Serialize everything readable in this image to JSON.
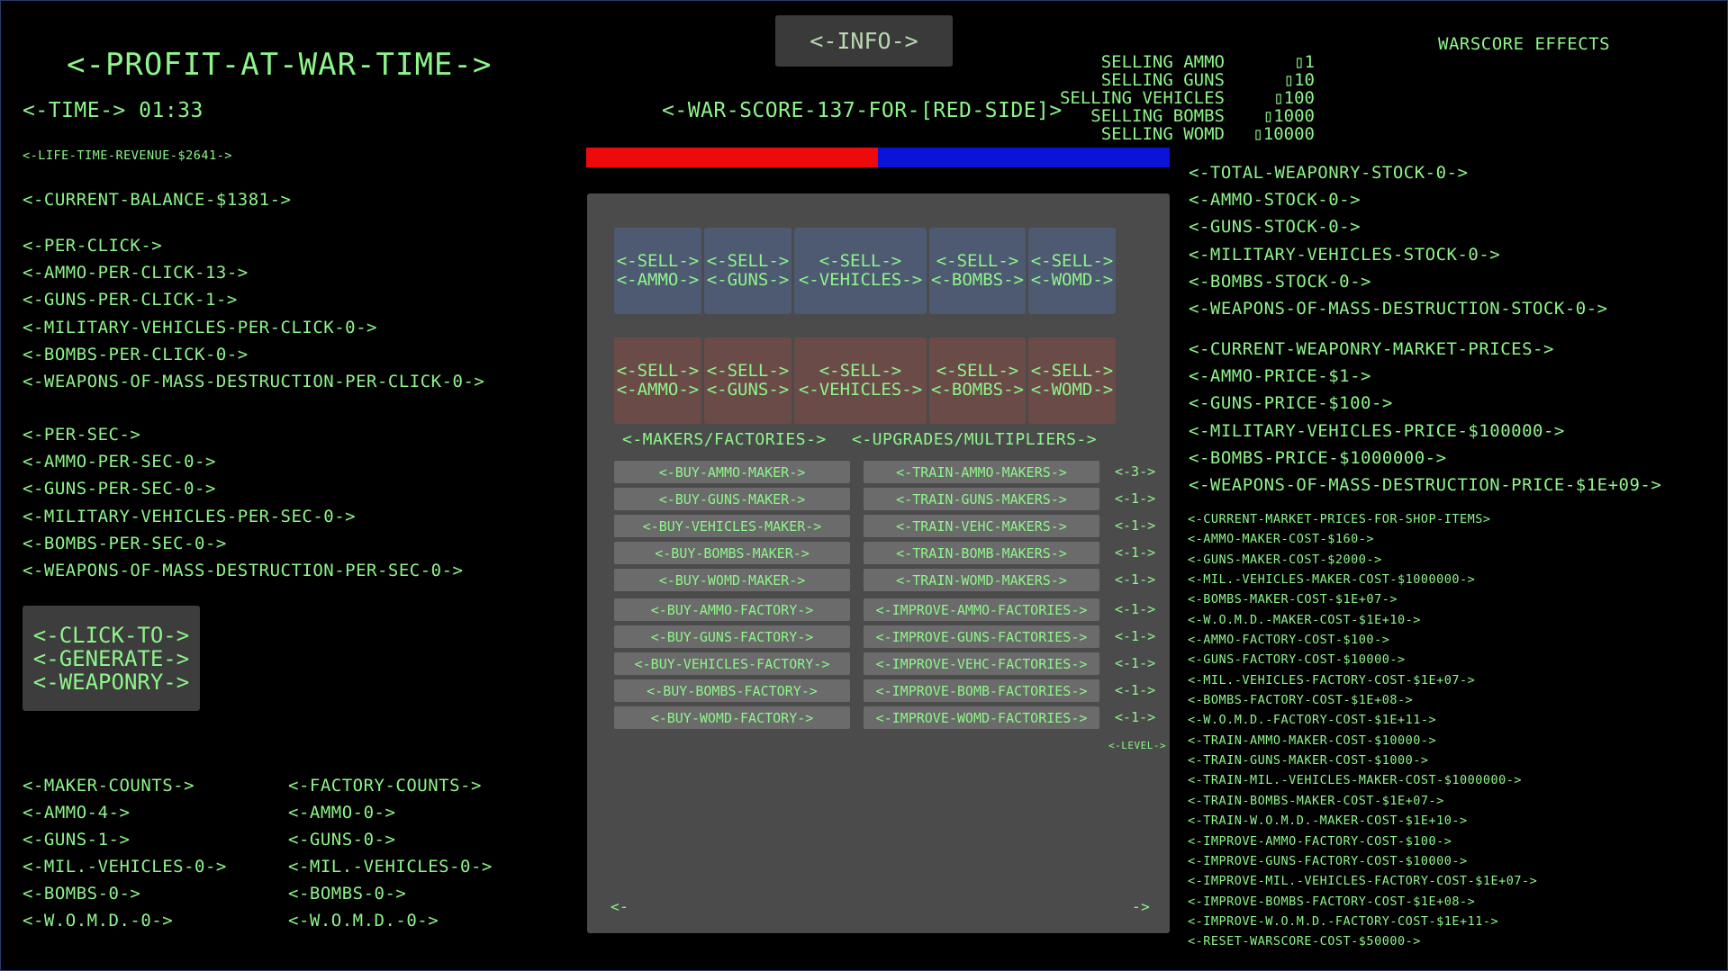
{
  "title": "<-PROFIT-AT-WAR-TIME->",
  "time": "<-TIME-> 01:33",
  "lifetime_revenue": "<-LIFE-TIME-REVENUE-$2641->",
  "current_balance": "<-CURRENT-BALANCE-$1381->",
  "per_click": [
    "<-PER-CLICK->",
    "<-AMMO-PER-CLICK-13->",
    "<-GUNS-PER-CLICK-1->",
    "<-MILITARY-VEHICLES-PER-CLICK-0->",
    "<-BOMBS-PER-CLICK-0->",
    "<-WEAPONS-OF-MASS-DESTRUCTION-PER-CLICK-0->"
  ],
  "per_sec": [
    "<-PER-SEC->",
    "<-AMMO-PER-SEC-0->",
    "<-GUNS-PER-SEC-0->",
    "<-MILITARY-VEHICLES-PER-SEC-0->",
    "<-BOMBS-PER-SEC-0->",
    "<-WEAPONS-OF-MASS-DESTRUCTION-PER-SEC-0->"
  ],
  "generate_button": [
    "<-CLICK-TO->",
    "<-GENERATE->",
    "<-WEAPONRY->"
  ],
  "maker_counts": [
    "<-MAKER-COUNTS->",
    "<-AMMO-4->",
    "<-GUNS-1->",
    "<-MIL.-VEHICLES-0->",
    "<-BOMBS-0->",
    "<-W.O.M.D.-0->"
  ],
  "factory_counts": [
    "<-FACTORY-COUNTS->",
    "<-AMMO-0->",
    "<-GUNS-0->",
    "<-MIL.-VEHICLES-0->",
    "<-BOMBS-0->",
    "<-W.O.M.D.-0->"
  ],
  "info_button": "<-INFO->",
  "war_score": "<-WAR-SCORE-137-FOR-[RED-SIDE]>",
  "war_bar": {
    "red_fraction": 0.5,
    "red_color": "#ee0a0a",
    "blue_color": "#0a14d8"
  },
  "sell_blue": [
    [
      "<-SELL->",
      "<-AMMO->"
    ],
    [
      "<-SELL->",
      "<-GUNS->"
    ],
    [
      "<-SELL->",
      "<-VEHICLES->"
    ],
    [
      "<-SELL->",
      "<-BOMBS->"
    ],
    [
      "<-SELL->",
      "<-WOMD->"
    ]
  ],
  "sell_red": [
    [
      "<-SELL->",
      "<-AMMO->"
    ],
    [
      "<-SELL->",
      "<-GUNS->"
    ],
    [
      "<-SELL->",
      "<-VEHICLES->"
    ],
    [
      "<-SELL->",
      "<-BOMBS->"
    ],
    [
      "<-SELL->",
      "<-WOMD->"
    ]
  ],
  "makers_header": "<-MAKERS/FACTORIES->",
  "upgrades_header": "<-UPGRADES/MULTIPLIERS->",
  "makers_buttons": [
    "<-BUY-AMMO-MAKER->",
    "<-BUY-GUNS-MAKER->",
    "<-BUY-VEHICLES-MAKER->",
    "<-BUY-BOMBS-MAKER->",
    "<-BUY-WOMD-MAKER->",
    "<-BUY-AMMO-FACTORY->",
    "<-BUY-GUNS-FACTORY->",
    "<-BUY-VEHICLES-FACTORY->",
    "<-BUY-BOMBS-FACTORY->",
    "<-BUY-WOMD-FACTORY->"
  ],
  "upgrade_buttons": [
    "<-TRAIN-AMMO-MAKERS->",
    "<-TRAIN-GUNS-MAKERS->",
    "<-TRAIN-VEHC-MAKERS->",
    "<-TRAIN-BOMB-MAKERS->",
    "<-TRAIN-WOMD-MAKERS->",
    "<-IMPROVE-AMMO-FACTORIES->",
    "<-IMPROVE-GUNS-FACTORIES->",
    "<-IMPROVE-VEHC-FACTORIES->",
    "<-IMPROVE-BOMB-FACTORIES->",
    "<-IMPROVE-WOMD-FACTORIES->"
  ],
  "levels": [
    "<-3->",
    "<-1->",
    "<-1->",
    "<-1->",
    "<-1->",
    "<-1->",
    "<-1->",
    "<-1->",
    "<-1->",
    "<-1->"
  ],
  "level_label": "<-LEVEL->",
  "page_prev": "<-",
  "page_next": "->",
  "warscore_effects": {
    "title": "WARSCORE EFFECTS",
    "rows": [
      {
        "label": "SELLING AMMO",
        "value": "▯1"
      },
      {
        "label": "SELLING GUNS",
        "value": "▯10"
      },
      {
        "label": "SELLING VEHICLES",
        "value": "▯100"
      },
      {
        "label": "SELLING BOMBS",
        "value": "▯1000"
      },
      {
        "label": "SELLING WOMD",
        "value": "▯10000"
      }
    ]
  },
  "stock": [
    "<-TOTAL-WEAPONRY-STOCK-0->",
    "<-AMMO-STOCK-0->",
    "<-GUNS-STOCK-0->",
    "<-MILITARY-VEHICLES-STOCK-0->",
    "<-BOMBS-STOCK-0->",
    "<-WEAPONS-OF-MASS-DESTRUCTION-STOCK-0->"
  ],
  "prices": [
    "<-CURRENT-WEAPONRY-MARKET-PRICES->",
    "<-AMMO-PRICE-$1->",
    "<-GUNS-PRICE-$100->",
    "<-MILITARY-VEHICLES-PRICE-$100000->",
    "<-BOMBS-PRICE-$1000000->",
    "<-WEAPONS-OF-MASS-DESTRUCTION-PRICE-$1E+09->"
  ],
  "shop_prices": [
    "<-CURRENT-MARKET-PRICES-FOR-SHOP-ITEMS>",
    "<-AMMO-MAKER-COST-$160->",
    "<-GUNS-MAKER-COST-$2000->",
    "<-MIL.-VEHICLES-MAKER-COST-$1000000->",
    "<-BOMBS-MAKER-COST-$1E+07->",
    "<-W.O.M.D.-MAKER-COST-$1E+10->",
    "<-AMMO-FACTORY-COST-$100->",
    "<-GUNS-FACTORY-COST-$10000->",
    "<-MIL.-VEHICLES-FACTORY-COST-$1E+07->",
    "<-BOMBS-FACTORY-COST-$1E+08->",
    "<-W.O.M.D.-FACTORY-COST-$1E+11->",
    "<-TRAIN-AMMO-MAKER-COST-$10000->",
    "<-TRAIN-GUNS-MAKER-COST-$1000->",
    "<-TRAIN-MIL.-VEHICLES-MAKER-COST-$1000000->",
    "<-TRAIN-BOMBS-MAKER-COST-$1E+07->",
    "<-TRAIN-W.O.M.D.-MAKER-COST-$1E+10->",
    "<-IMPROVE-AMMO-FACTORY-COST-$100->",
    "<-IMPROVE-GUNS-FACTORY-COST-$10000->",
    "<-IMPROVE-MIL.-VEHICLES-FACTORY-COST-$1E+07->",
    "<-IMPROVE-BOMBS-FACTORY-COST-$1E+08->",
    "<-IMPROVE-W.O.M.D.-FACTORY-COST-$1E+11->",
    "<-RESET-WARSCORE-COST-$50000->"
  ]
}
